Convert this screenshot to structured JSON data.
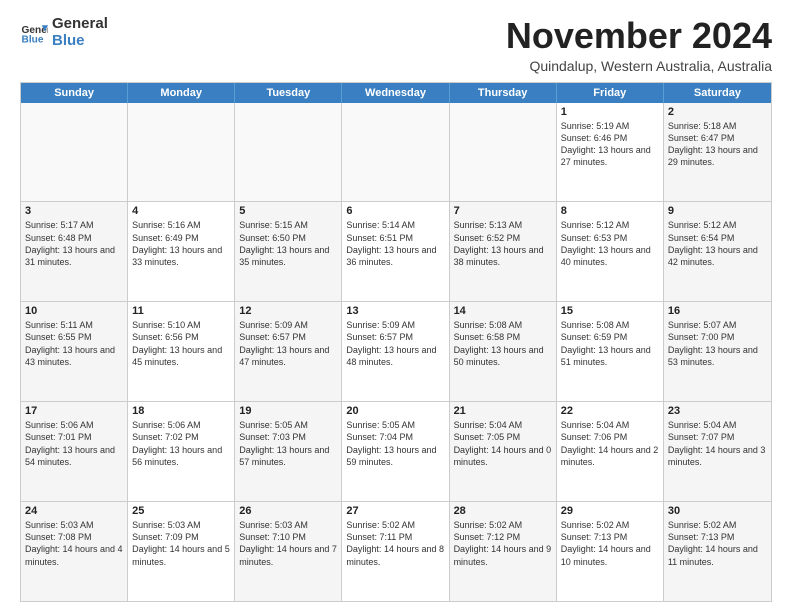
{
  "logo": {
    "general": "General",
    "blue": "Blue"
  },
  "title": "November 2024",
  "subtitle": "Quindalup, Western Australia, Australia",
  "header_days": [
    "Sunday",
    "Monday",
    "Tuesday",
    "Wednesday",
    "Thursday",
    "Friday",
    "Saturday"
  ],
  "weeks": [
    [
      {
        "day": "",
        "content": ""
      },
      {
        "day": "",
        "content": ""
      },
      {
        "day": "",
        "content": ""
      },
      {
        "day": "",
        "content": ""
      },
      {
        "day": "",
        "content": ""
      },
      {
        "day": "1",
        "content": "Sunrise: 5:19 AM\nSunset: 6:46 PM\nDaylight: 13 hours\nand 27 minutes."
      },
      {
        "day": "2",
        "content": "Sunrise: 5:18 AM\nSunset: 6:47 PM\nDaylight: 13 hours\nand 29 minutes."
      }
    ],
    [
      {
        "day": "3",
        "content": "Sunrise: 5:17 AM\nSunset: 6:48 PM\nDaylight: 13 hours\nand 31 minutes."
      },
      {
        "day": "4",
        "content": "Sunrise: 5:16 AM\nSunset: 6:49 PM\nDaylight: 13 hours\nand 33 minutes."
      },
      {
        "day": "5",
        "content": "Sunrise: 5:15 AM\nSunset: 6:50 PM\nDaylight: 13 hours\nand 35 minutes."
      },
      {
        "day": "6",
        "content": "Sunrise: 5:14 AM\nSunset: 6:51 PM\nDaylight: 13 hours\nand 36 minutes."
      },
      {
        "day": "7",
        "content": "Sunrise: 5:13 AM\nSunset: 6:52 PM\nDaylight: 13 hours\nand 38 minutes."
      },
      {
        "day": "8",
        "content": "Sunrise: 5:12 AM\nSunset: 6:53 PM\nDaylight: 13 hours\nand 40 minutes."
      },
      {
        "day": "9",
        "content": "Sunrise: 5:12 AM\nSunset: 6:54 PM\nDaylight: 13 hours\nand 42 minutes."
      }
    ],
    [
      {
        "day": "10",
        "content": "Sunrise: 5:11 AM\nSunset: 6:55 PM\nDaylight: 13 hours\nand 43 minutes."
      },
      {
        "day": "11",
        "content": "Sunrise: 5:10 AM\nSunset: 6:56 PM\nDaylight: 13 hours\nand 45 minutes."
      },
      {
        "day": "12",
        "content": "Sunrise: 5:09 AM\nSunset: 6:57 PM\nDaylight: 13 hours\nand 47 minutes."
      },
      {
        "day": "13",
        "content": "Sunrise: 5:09 AM\nSunset: 6:57 PM\nDaylight: 13 hours\nand 48 minutes."
      },
      {
        "day": "14",
        "content": "Sunrise: 5:08 AM\nSunset: 6:58 PM\nDaylight: 13 hours\nand 50 minutes."
      },
      {
        "day": "15",
        "content": "Sunrise: 5:08 AM\nSunset: 6:59 PM\nDaylight: 13 hours\nand 51 minutes."
      },
      {
        "day": "16",
        "content": "Sunrise: 5:07 AM\nSunset: 7:00 PM\nDaylight: 13 hours\nand 53 minutes."
      }
    ],
    [
      {
        "day": "17",
        "content": "Sunrise: 5:06 AM\nSunset: 7:01 PM\nDaylight: 13 hours\nand 54 minutes."
      },
      {
        "day": "18",
        "content": "Sunrise: 5:06 AM\nSunset: 7:02 PM\nDaylight: 13 hours\nand 56 minutes."
      },
      {
        "day": "19",
        "content": "Sunrise: 5:05 AM\nSunset: 7:03 PM\nDaylight: 13 hours\nand 57 minutes."
      },
      {
        "day": "20",
        "content": "Sunrise: 5:05 AM\nSunset: 7:04 PM\nDaylight: 13 hours\nand 59 minutes."
      },
      {
        "day": "21",
        "content": "Sunrise: 5:04 AM\nSunset: 7:05 PM\nDaylight: 14 hours\nand 0 minutes."
      },
      {
        "day": "22",
        "content": "Sunrise: 5:04 AM\nSunset: 7:06 PM\nDaylight: 14 hours\nand 2 minutes."
      },
      {
        "day": "23",
        "content": "Sunrise: 5:04 AM\nSunset: 7:07 PM\nDaylight: 14 hours\nand 3 minutes."
      }
    ],
    [
      {
        "day": "24",
        "content": "Sunrise: 5:03 AM\nSunset: 7:08 PM\nDaylight: 14 hours\nand 4 minutes."
      },
      {
        "day": "25",
        "content": "Sunrise: 5:03 AM\nSunset: 7:09 PM\nDaylight: 14 hours\nand 5 minutes."
      },
      {
        "day": "26",
        "content": "Sunrise: 5:03 AM\nSunset: 7:10 PM\nDaylight: 14 hours\nand 7 minutes."
      },
      {
        "day": "27",
        "content": "Sunrise: 5:02 AM\nSunset: 7:11 PM\nDaylight: 14 hours\nand 8 minutes."
      },
      {
        "day": "28",
        "content": "Sunrise: 5:02 AM\nSunset: 7:12 PM\nDaylight: 14 hours\nand 9 minutes."
      },
      {
        "day": "29",
        "content": "Sunrise: 5:02 AM\nSunset: 7:13 PM\nDaylight: 14 hours\nand 10 minutes."
      },
      {
        "day": "30",
        "content": "Sunrise: 5:02 AM\nSunset: 7:13 PM\nDaylight: 14 hours\nand 11 minutes."
      }
    ]
  ]
}
